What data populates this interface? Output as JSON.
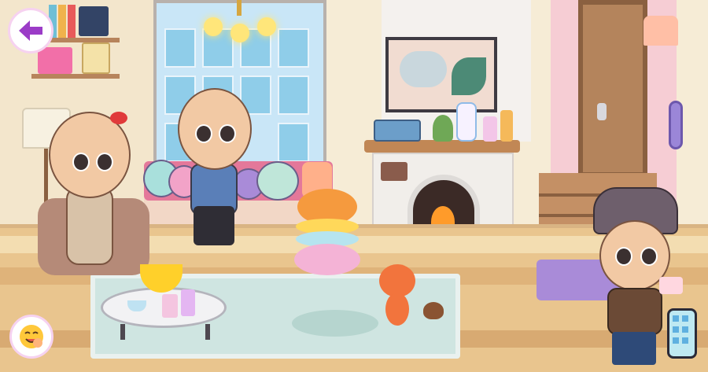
{
  "scene": {
    "room": "living-room",
    "colors": {
      "wall": "#f6ecd6",
      "floor": "#e9c58e",
      "rug": "#cfe5e1",
      "accent_purple": "#9b3cc7",
      "fire": "#ff9b2a"
    }
  },
  "hud": {
    "back_button": {
      "icon": "back-arrow-icon"
    },
    "emote_button": {
      "icon": "emoji-face-icon"
    },
    "phone_button": {
      "icon": "phone-icon"
    }
  },
  "characters": [
    {
      "id": "grandma",
      "pose": "seated-armchair"
    },
    {
      "id": "grandpa",
      "pose": "standing"
    },
    {
      "id": "man-in-fedora",
      "pose": "standing"
    },
    {
      "id": "cat",
      "pose": "sitting"
    }
  ]
}
